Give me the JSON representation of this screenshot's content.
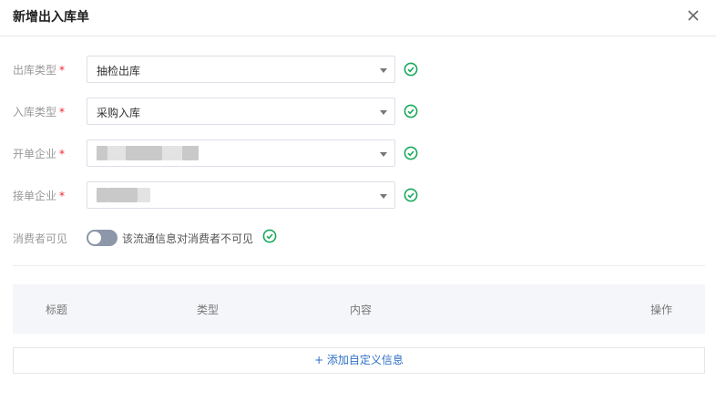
{
  "dialog": {
    "title": "新增出入库单",
    "close_icon": "close-icon"
  },
  "form": {
    "out_type": {
      "label": "出库类型",
      "required": "*",
      "value": "抽检出库"
    },
    "in_type": {
      "label": "入库类型",
      "required": "*",
      "value": "采购入库"
    },
    "issuer": {
      "label": "开单企业",
      "required": "*",
      "value": ""
    },
    "receiver": {
      "label": "接单企业",
      "required": "*",
      "value": ""
    },
    "consumer": {
      "label": "消费者可见",
      "toggle_text": "该流通信息对消费者不可见",
      "enabled": false
    }
  },
  "table": {
    "columns": [
      "标题",
      "类型",
      "内容",
      "操作"
    ],
    "add_label": "+ 添加自定义信息"
  },
  "colors": {
    "accent": "#2f6fc6",
    "check": "#1aa95b",
    "required": "#f5222d"
  }
}
